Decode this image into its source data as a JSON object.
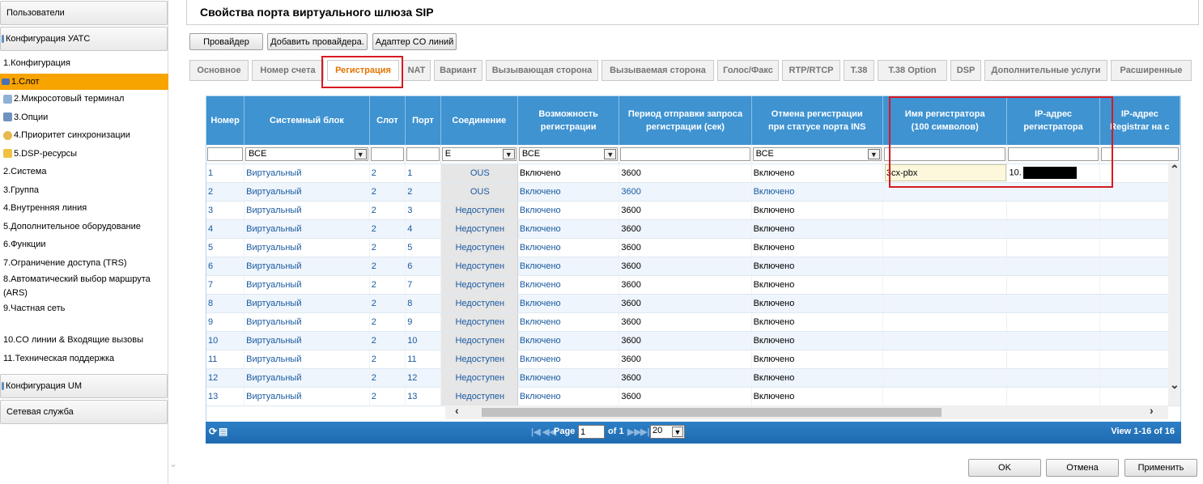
{
  "sidebar": {
    "users": "Пользователи",
    "pbx_config": "Конфигурация УАТС",
    "items": [
      {
        "label": "1.Конфигурация"
      },
      {
        "label": "1.Слот"
      },
      {
        "label": "2.Микросотовый терминал"
      },
      {
        "label": "3.Опции"
      },
      {
        "label": "4.Приоритет синхронизации"
      },
      {
        "label": "5.DSP-ресурсы"
      },
      {
        "label": "2.Система"
      },
      {
        "label": "3.Группа"
      },
      {
        "label": "4.Внутренняя линия"
      },
      {
        "label": "5.Дополнительное оборудование"
      },
      {
        "label": "6.Функции"
      },
      {
        "label": "7.Ограничение доступа (TRS)"
      },
      {
        "label": "8.Автоматический выбор маршрута"
      },
      {
        "label": "(ARS)"
      },
      {
        "label": "9.Частная сеть"
      },
      {
        "label": "10.CO линии & Входящие вызовы"
      },
      {
        "label": "11.Техническая поддержка"
      }
    ],
    "um_config": "Конфигурация UM",
    "network": "Сетевая служба"
  },
  "header": {
    "title": "Свойства порта виртуального шлюза SIP"
  },
  "toolbar": {
    "provider": "Провайдер",
    "add_provider": "Добавить провайдера.",
    "co_adapter": "Адаптер CO линий"
  },
  "tabs": [
    "Основное",
    "Номер счета",
    "Регистрация",
    "NAT",
    "Вариант",
    "Вызывающая сторона",
    "Вызываемая сторона",
    "Голос/Факс",
    "RTP/RTCP",
    "T.38",
    "T.38 Option",
    "DSP",
    "Дополнительные услуги",
    "Расширенные"
  ],
  "grid": {
    "headers": {
      "num": "Номер",
      "unit": "Системный блок",
      "slot": "Слот",
      "port": "Порт",
      "conn": "Соединение",
      "reg_ability_1": "Возможность",
      "reg_ability_2": "регистрации",
      "period_1": "Период отправки запроса",
      "period_2": "регистрации (сек)",
      "cancel_1": "Отмена регистрации",
      "cancel_2": "при статусе порта INS",
      "registrar_name_1": "Имя регистратора",
      "registrar_name_2": "(100 символов)",
      "registrar_ip_1": "IP-адрес",
      "registrar_ip_2": "регистратора",
      "ip3_1": "IP-адрес",
      "ip3_2": "Registrar на с"
    },
    "filters": {
      "unit": "ВСЕ",
      "conn": "Е",
      "reg_ability": "ВСЕ",
      "cancel": "ВСЕ"
    },
    "rows": [
      {
        "num": "1",
        "unit": "Виртуальный",
        "slot": "2",
        "port": "1",
        "conn": "OUS",
        "reg": "Включено",
        "period": "3600",
        "cancel": "Включено",
        "name": "3cx-pbx",
        "ip": "10."
      },
      {
        "num": "2",
        "unit": "Виртуальный",
        "slot": "2",
        "port": "2",
        "conn": "OUS",
        "reg": "Включено",
        "period": "3600",
        "cancel": "Включено",
        "name": "",
        "ip": ""
      },
      {
        "num": "3",
        "unit": "Виртуальный",
        "slot": "2",
        "port": "3",
        "conn": "Недоступен",
        "reg": "Включено",
        "period": "3600",
        "cancel": "Включено",
        "name": "",
        "ip": ""
      },
      {
        "num": "4",
        "unit": "Виртуальный",
        "slot": "2",
        "port": "4",
        "conn": "Недоступен",
        "reg": "Включено",
        "period": "3600",
        "cancel": "Включено",
        "name": "",
        "ip": ""
      },
      {
        "num": "5",
        "unit": "Виртуальный",
        "slot": "2",
        "port": "5",
        "conn": "Недоступен",
        "reg": "Включено",
        "period": "3600",
        "cancel": "Включено",
        "name": "",
        "ip": ""
      },
      {
        "num": "6",
        "unit": "Виртуальный",
        "slot": "2",
        "port": "6",
        "conn": "Недоступен",
        "reg": "Включено",
        "period": "3600",
        "cancel": "Включено",
        "name": "",
        "ip": ""
      },
      {
        "num": "7",
        "unit": "Виртуальный",
        "slot": "2",
        "port": "7",
        "conn": "Недоступен",
        "reg": "Включено",
        "period": "3600",
        "cancel": "Включено",
        "name": "",
        "ip": ""
      },
      {
        "num": "8",
        "unit": "Виртуальный",
        "slot": "2",
        "port": "8",
        "conn": "Недоступен",
        "reg": "Включено",
        "period": "3600",
        "cancel": "Включено",
        "name": "",
        "ip": ""
      },
      {
        "num": "9",
        "unit": "Виртуальный",
        "slot": "2",
        "port": "9",
        "conn": "Недоступен",
        "reg": "Включено",
        "period": "3600",
        "cancel": "Включено",
        "name": "",
        "ip": ""
      },
      {
        "num": "10",
        "unit": "Виртуальный",
        "slot": "2",
        "port": "10",
        "conn": "Недоступен",
        "reg": "Включено",
        "period": "3600",
        "cancel": "Включено",
        "name": "",
        "ip": ""
      },
      {
        "num": "11",
        "unit": "Виртуальный",
        "slot": "2",
        "port": "11",
        "conn": "Недоступен",
        "reg": "Включено",
        "period": "3600",
        "cancel": "Включено",
        "name": "",
        "ip": ""
      },
      {
        "num": "12",
        "unit": "Виртуальный",
        "slot": "2",
        "port": "12",
        "conn": "Недоступен",
        "reg": "Включено",
        "period": "3600",
        "cancel": "Включено",
        "name": "",
        "ip": ""
      },
      {
        "num": "13",
        "unit": "Виртуальный",
        "slot": "2",
        "port": "13",
        "conn": "Недоступен",
        "reg": "Включено",
        "period": "3600",
        "cancel": "Включено",
        "name": "",
        "ip": ""
      }
    ]
  },
  "pager": {
    "page_label": "Page",
    "page_value": "1",
    "of_label": "of 1",
    "rows_per_page": "20",
    "view": "View 1-16 of 16"
  },
  "buttons": {
    "ok": "OK",
    "cancel": "Отмена",
    "apply": "Применить"
  },
  "colors": {
    "accent": "#f7a300",
    "header_blue": "#3f93d1",
    "highlight_red": "#d71920",
    "active_tab": "#e37400"
  }
}
